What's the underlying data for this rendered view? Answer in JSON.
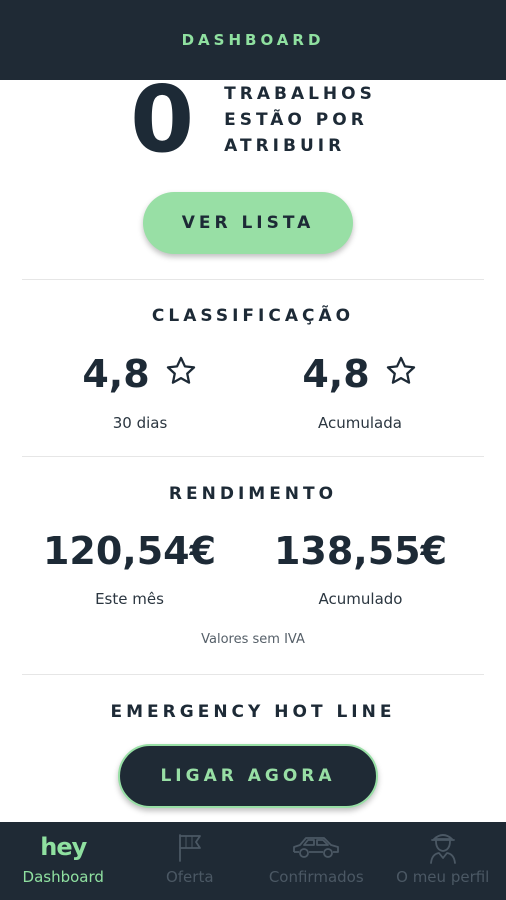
{
  "header": {
    "title": "DASHBOARD"
  },
  "pending": {
    "count": "0",
    "lines": [
      "TRABALHOS",
      "ESTÃO POR",
      "ATRIBUIR"
    ],
    "button_label": "VER LISTA"
  },
  "rating": {
    "title": "CLASSIFICAÇÃO",
    "items": [
      {
        "value": "4,8",
        "caption": "30 dias",
        "icon": "star-outline-icon"
      },
      {
        "value": "4,8",
        "caption": "Acumulada",
        "icon": "star-outline-icon"
      }
    ]
  },
  "income": {
    "title": "RENDIMENTO",
    "items": [
      {
        "value": "120,54€",
        "caption": "Este mês"
      },
      {
        "value": "138,55€",
        "caption": "Acumulado"
      }
    ],
    "note": "Valores sem IVA"
  },
  "emergency": {
    "title": "EMERGENCY HOT LINE",
    "button_label": "LIGAR AGORA"
  },
  "nav": {
    "items": [
      {
        "label": "Dashboard",
        "icon": "hey-logo",
        "logo_text": "hey",
        "active": true
      },
      {
        "label": "Oferta",
        "icon": "flag-icon",
        "active": false
      },
      {
        "label": "Confirmados",
        "icon": "car-icon",
        "active": false
      },
      {
        "label": "O meu perfil",
        "icon": "driver-icon",
        "active": false
      }
    ]
  },
  "colors": {
    "navy": "#1f2a35",
    "accent_green": "#98dfa5",
    "text_dark": "#1d2a36",
    "nav_inactive": "#4b5864"
  }
}
